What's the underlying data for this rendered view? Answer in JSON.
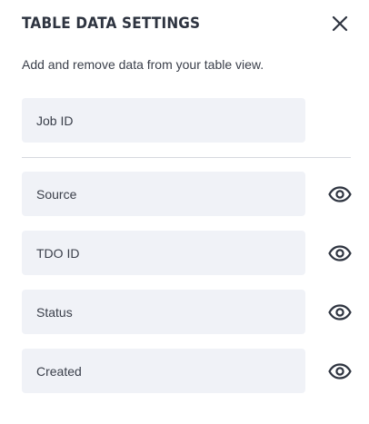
{
  "dialog": {
    "title": "TABLE DATA SETTINGS",
    "subtitle": "Add and remove data from your table view.",
    "close_icon": "close-icon"
  },
  "fixed_column": {
    "label": "Job ID"
  },
  "columns": [
    {
      "label": "Source",
      "visibility_icon": "eye-icon"
    },
    {
      "label": "TDO ID",
      "visibility_icon": "eye-icon"
    },
    {
      "label": "Status",
      "visibility_icon": "eye-icon"
    },
    {
      "label": "Created",
      "visibility_icon": "eye-icon"
    }
  ],
  "colors": {
    "field_background": "#f0f2f7",
    "icon": "#2e3440",
    "divider": "#d6d9df"
  }
}
